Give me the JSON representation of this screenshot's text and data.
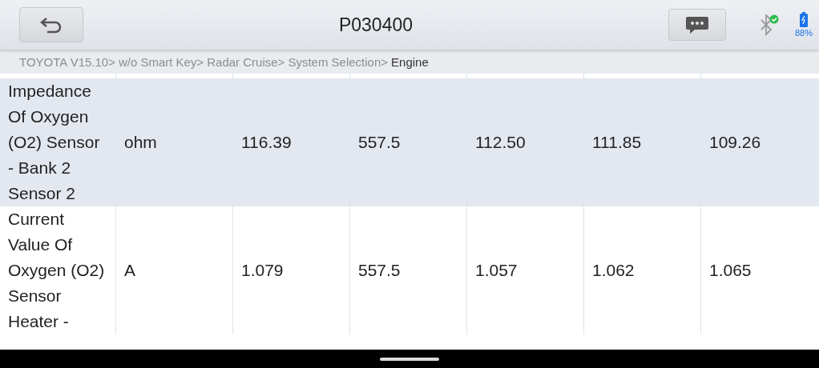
{
  "header": {
    "title": "P030400",
    "battery": "88%",
    "bluetooth_connected": true
  },
  "breadcrumb": [
    {
      "label": "TOYOTA V15.10>",
      "current": false
    },
    {
      "label": "w/o Smart Key>",
      "current": false
    },
    {
      "label": "Radar Cruise>",
      "current": false
    },
    {
      "label": "System Selection>",
      "current": false
    },
    {
      "label": "Engine",
      "current": true
    }
  ],
  "table": {
    "rows": [
      {
        "name": "Impedance Of Oxygen (O2) Sensor - Bank 2 Sensor 2",
        "unit": "ohm",
        "values": [
          "116.39",
          "557.5",
          "112.50",
          "111.85",
          "109.26"
        ],
        "selected": true
      },
      {
        "name": "Current Value Of Oxygen (O2) Sensor Heater -",
        "unit": "A",
        "values": [
          "1.079",
          "557.5",
          "1.057",
          "1.062",
          "1.065"
        ],
        "selected": false
      }
    ]
  }
}
